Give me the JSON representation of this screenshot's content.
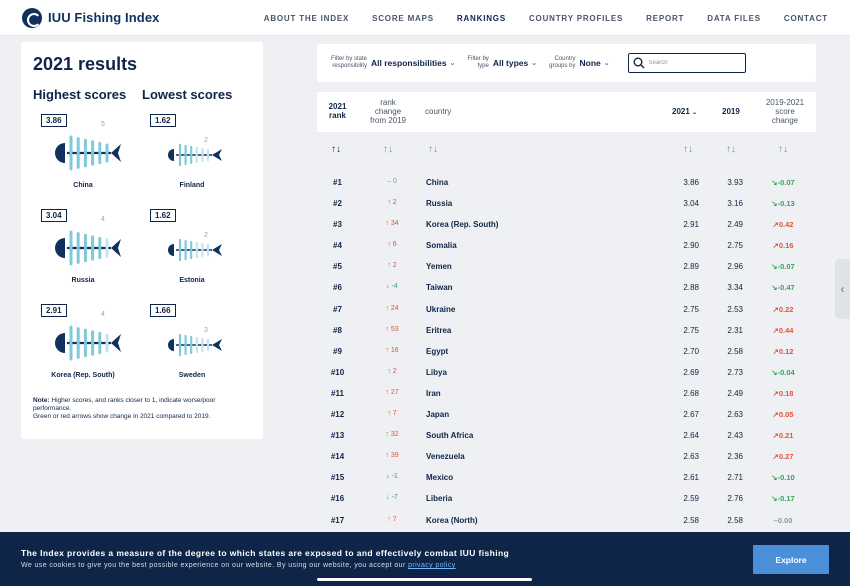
{
  "header": {
    "logo_text": "IUU Fishing Index",
    "nav": [
      "ABOUT THE INDEX",
      "SCORE MAPS",
      "RANKINGS",
      "COUNTRY PROFILES",
      "REPORT",
      "DATA FILES",
      "CONTACT"
    ],
    "active": "RANKINGS"
  },
  "results": {
    "title": "2021 results",
    "highest_label": "Highest scores",
    "lowest_label": "Lowest scores",
    "highest": [
      {
        "score": "3.86",
        "rank": "5",
        "country": "China",
        "fill": 0.96
      },
      {
        "score": "3.04",
        "rank": "4",
        "country": "Russia",
        "fill": 0.76
      },
      {
        "score": "2.91",
        "rank": "4",
        "country": "Korea (Rep. South)",
        "fill": 0.73
      }
    ],
    "lowest": [
      {
        "score": "1.62",
        "rank": "2",
        "country": "Finland",
        "fill": 0.4
      },
      {
        "score": "1.62",
        "rank": "2",
        "country": "Estonia",
        "fill": 0.4
      },
      {
        "score": "1.66",
        "rank": "3",
        "country": "Sweden",
        "fill": 0.42
      }
    ],
    "note_bold": "Note:",
    "note_1": " Higher scores, and ranks closer to 1, indicate worse/poor performance.",
    "note_2": "Green or red arrows show change in 2021 compared to 2019."
  },
  "filters": {
    "responsibility_label_1": "Filter by state",
    "responsibility_label_2": "responsibility",
    "responsibility_value": "All responsibilities",
    "type_label_1": "Filter by",
    "type_label_2": "type",
    "type_value": "All types",
    "groups_label_1": "Country",
    "groups_label_2": "groups by",
    "groups_value": "None",
    "search_placeholder": "Search"
  },
  "table": {
    "headers": {
      "rank_1": "2021",
      "rank_2": "rank",
      "change_1": "rank",
      "change_2": "change",
      "change_3": "from 2019",
      "country": "country",
      "y2021": "2021",
      "y2019": "2019",
      "delta_1": "2019-2021",
      "delta_2": "score",
      "delta_3": "change"
    },
    "rows": [
      {
        "rank": "#1",
        "change": "0",
        "dir": "neutral",
        "country": "China",
        "s2021": "3.86",
        "s2019": "3.93",
        "delta": "-0.07",
        "ddir": "down"
      },
      {
        "rank": "#2",
        "change": "2",
        "dir": "up",
        "country": "Russia",
        "s2021": "3.04",
        "s2019": "3.16",
        "delta": "-0.13",
        "ddir": "down"
      },
      {
        "rank": "#3",
        "change": "34",
        "dir": "up",
        "country": "Korea (Rep. South)",
        "s2021": "2.91",
        "s2019": "2.49",
        "delta": "0.42",
        "ddir": "up"
      },
      {
        "rank": "#4",
        "change": "6",
        "dir": "up",
        "country": "Somalia",
        "s2021": "2.90",
        "s2019": "2.75",
        "delta": "0.16",
        "ddir": "up"
      },
      {
        "rank": "#5",
        "change": "2",
        "dir": "up",
        "country": "Yemen",
        "s2021": "2.89",
        "s2019": "2.96",
        "delta": "-0.07",
        "ddir": "down"
      },
      {
        "rank": "#6",
        "change": "-4",
        "dir": "down",
        "country": "Taiwan",
        "s2021": "2.88",
        "s2019": "3.34",
        "delta": "-0.47",
        "ddir": "down"
      },
      {
        "rank": "#7",
        "change": "24",
        "dir": "up",
        "country": "Ukraine",
        "s2021": "2.75",
        "s2019": "2.53",
        "delta": "0.22",
        "ddir": "up"
      },
      {
        "rank": "#8",
        "change": "53",
        "dir": "up",
        "country": "Eritrea",
        "s2021": "2.75",
        "s2019": "2.31",
        "delta": "0.44",
        "ddir": "up"
      },
      {
        "rank": "#9",
        "change": "16",
        "dir": "up",
        "country": "Egypt",
        "s2021": "2.70",
        "s2019": "2.58",
        "delta": "0.12",
        "ddir": "up"
      },
      {
        "rank": "#10",
        "change": "2",
        "dir": "up",
        "country": "Libya",
        "s2021": "2.69",
        "s2019": "2.73",
        "delta": "-0.04",
        "ddir": "down"
      },
      {
        "rank": "#11",
        "change": "27",
        "dir": "up",
        "country": "Iran",
        "s2021": "2.68",
        "s2019": "2.49",
        "delta": "0.18",
        "ddir": "up"
      },
      {
        "rank": "#12",
        "change": "7",
        "dir": "up",
        "country": "Japan",
        "s2021": "2.67",
        "s2019": "2.63",
        "delta": "0.05",
        "ddir": "up"
      },
      {
        "rank": "#13",
        "change": "32",
        "dir": "up",
        "country": "South Africa",
        "s2021": "2.64",
        "s2019": "2.43",
        "delta": "0.21",
        "ddir": "up"
      },
      {
        "rank": "#14",
        "change": "39",
        "dir": "up",
        "country": "Venezuela",
        "s2021": "2.63",
        "s2019": "2.36",
        "delta": "0.27",
        "ddir": "up"
      },
      {
        "rank": "#15",
        "change": "-1",
        "dir": "down",
        "country": "Mexico",
        "s2021": "2.61",
        "s2019": "2.71",
        "delta": "-0.10",
        "ddir": "down"
      },
      {
        "rank": "#16",
        "change": "-7",
        "dir": "down",
        "country": "Liberia",
        "s2021": "2.59",
        "s2019": "2.76",
        "delta": "-0.17",
        "ddir": "down"
      },
      {
        "rank": "#17",
        "change": "7",
        "dir": "up",
        "country": "Korea (North)",
        "s2021": "2.58",
        "s2019": "2.58",
        "delta": "0.00",
        "ddir": "neutral"
      }
    ]
  },
  "banner": {
    "title": "The Index provides a measure of the degree to which states are exposed to and effectively combat IUU fishing",
    "text": "We use cookies to give you the best possible experience on our website. By using our website, you accept our ",
    "link": "privacy policy",
    "button": "Explore"
  },
  "colors": {
    "navy": "#0f2548",
    "fish_dark": "#10305e",
    "fish_light": "#7fc9dc",
    "up_red": "#e0533d",
    "down_green": "#3aa35b",
    "explore_blue": "#4a90d9"
  }
}
